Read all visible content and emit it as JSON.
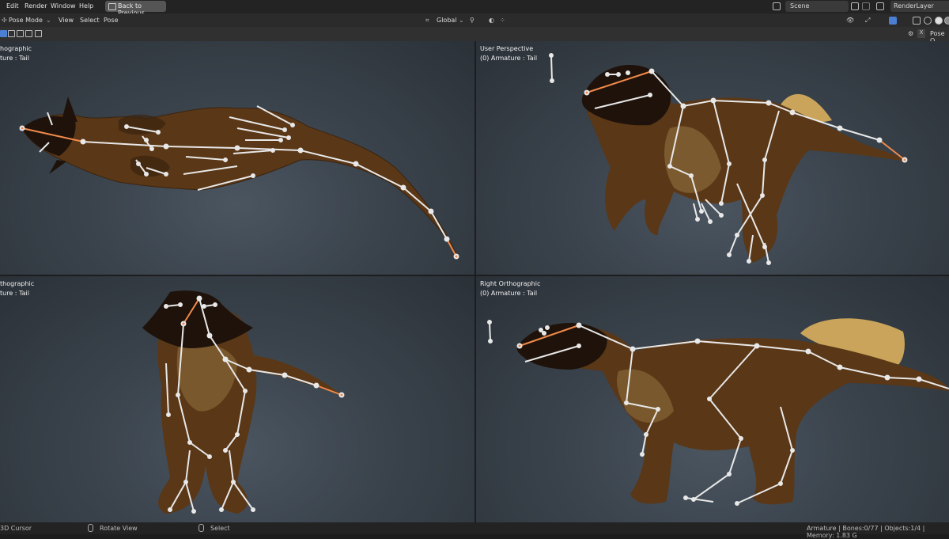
{
  "menu": {
    "edit": "Edit",
    "render": "Render",
    "window": "Window",
    "help": "Help",
    "back_to_previous": "Back to Previous",
    "scene": "Scene",
    "render_layer": "RenderLayer"
  },
  "header": {
    "mode": "Pose Mode",
    "view": "View",
    "select": "Select",
    "pose": "Pose",
    "orientation": "Global",
    "pose_option": "Pose O"
  },
  "viewports": {
    "top_left": {
      "title": "hographic",
      "subtitle": "ture : Tail"
    },
    "top_right": {
      "title": "User Perspective",
      "subtitle": "(0) Armature : Tail"
    },
    "bottom_left": {
      "title": "thographic",
      "subtitle": "ture : Tail"
    },
    "bottom_right": {
      "title": "Right Orthographic",
      "subtitle": "(0) Armature : Tail"
    }
  },
  "status": {
    "cursor": "3D Cursor",
    "rotate": "Rotate View",
    "select": "Select",
    "stats": "Armature | Bones:0/77 | Objects:1/4 | Memory: 1.83 G"
  },
  "colors": {
    "creature_skin": "#5a3716",
    "creature_head": "#1e120a",
    "feathers": "#c9a45a",
    "bone": "#e8e8e8",
    "active_bone": "#f08a4b"
  }
}
